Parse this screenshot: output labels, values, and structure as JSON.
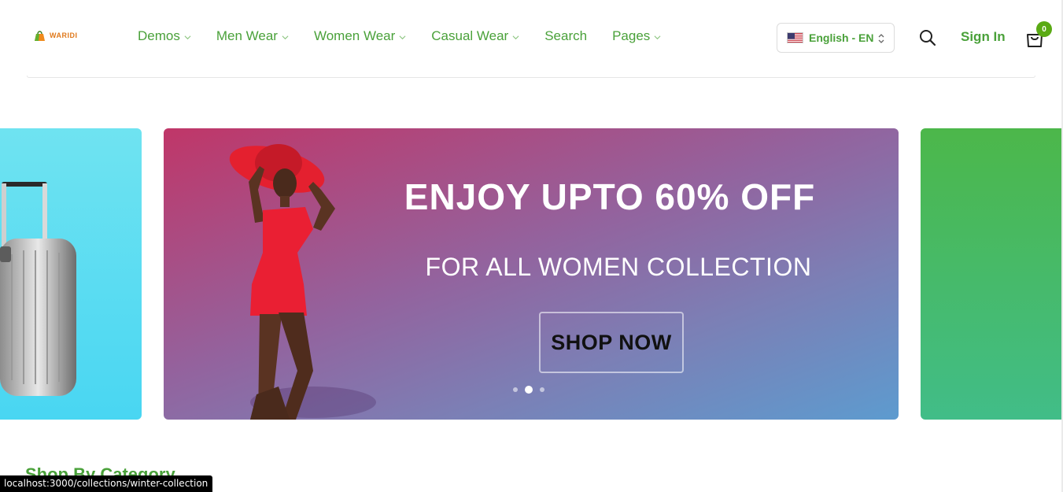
{
  "brand": {
    "name": "WARIDI",
    "logo_icon": "shopping-bag-icon"
  },
  "nav": {
    "items": [
      {
        "label": "Demos",
        "has_dropdown": true
      },
      {
        "label": "Men Wear",
        "has_dropdown": true
      },
      {
        "label": "Women Wear",
        "has_dropdown": true
      },
      {
        "label": "Casual Wear",
        "has_dropdown": true
      },
      {
        "label": "Search",
        "has_dropdown": false
      },
      {
        "label": "Pages",
        "has_dropdown": true
      }
    ]
  },
  "language": {
    "selected": "English - EN",
    "flag_icon": "us-flag-icon"
  },
  "header_actions": {
    "sign_in_label": "Sign In",
    "cart_count": "0"
  },
  "slider": {
    "active_index": 1,
    "slide_count": 3,
    "main": {
      "headline": "ENJOY UPTO 60% OFF",
      "subline": "FOR ALL WOMEN COLLECTION",
      "cta_label": "SHOP NOW"
    }
  },
  "section": {
    "title": "Shop By Category"
  },
  "status_bar": {
    "url": "localhost:3000/collections/winter-collection"
  },
  "colors": {
    "accent": "#4aa13a",
    "badge": "#5aaa14",
    "logo_text": "#e0791b"
  }
}
